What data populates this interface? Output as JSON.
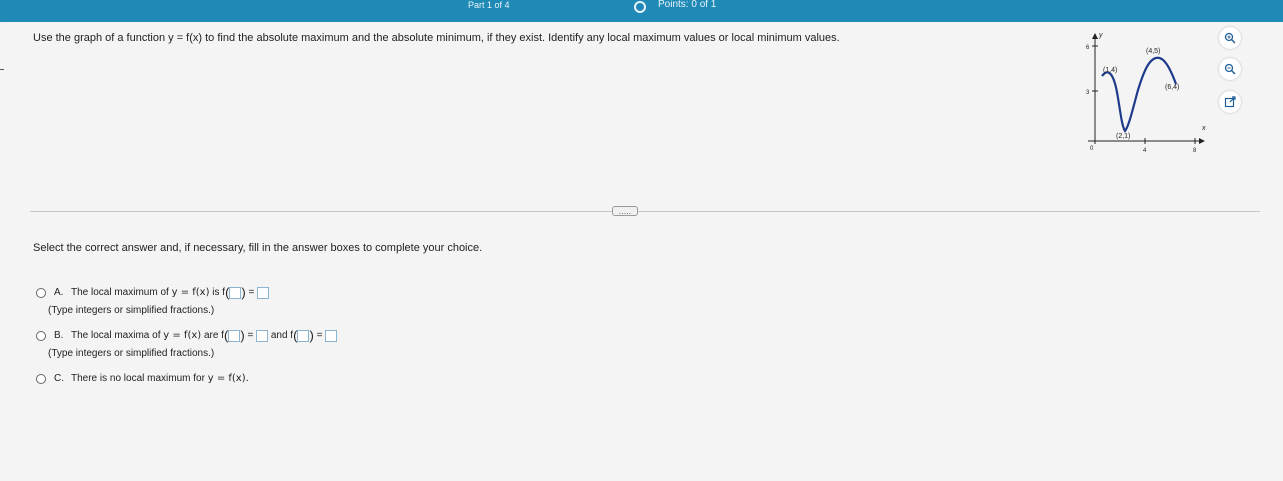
{
  "header": {
    "part": "Part 1 of 4",
    "points": "Points: 0 of 1"
  },
  "question": {
    "text": "Use the graph of a function y = f(x) to find the absolute maximum and the absolute minimum, if they exist. Identify any local maximum values or local minimum values."
  },
  "graph": {
    "axis_y": "y",
    "axis_x": "x",
    "y_tick_6": "6",
    "y_tick_3": "3",
    "origin": "0",
    "x_tick_4": "4",
    "x_tick_8": "8",
    "points": [
      {
        "label": "(1,4)",
        "x": 1,
        "y": 4
      },
      {
        "label": "(4,5)",
        "x": 4,
        "y": 5
      },
      {
        "label": "(6,4)",
        "x": 6,
        "y": 4
      },
      {
        "label": "(2,1)",
        "x": 2,
        "y": 1
      }
    ]
  },
  "tools": {
    "zoom_in": "zoom-in",
    "zoom_out": "zoom-out",
    "popout": "popout"
  },
  "divider": {
    "ellipsis": "....."
  },
  "instruction": "Select the correct answer and, if necessary, fill in the answer boxes to complete your choice.",
  "choices": {
    "a": {
      "letter": "A.",
      "text1": "The local maximum of",
      "fx": "y = f(x)",
      "text2": "is f",
      "eq": "=",
      "hint": "(Type integers or simplified fractions.)"
    },
    "b": {
      "letter": "B.",
      "text1": "The local maxima of",
      "fx": "y = f(x)",
      "text2": "are f",
      "eq1": "=",
      "and": "and f",
      "eq2": "=",
      "hint": "(Type integers or simplified fractions.)"
    },
    "c": {
      "letter": "C.",
      "text1": "There is no local maximum for",
      "fx": "y = f(x)."
    }
  },
  "colors": {
    "accent": "#1f8ab6",
    "curve": "#1e3a8a"
  }
}
